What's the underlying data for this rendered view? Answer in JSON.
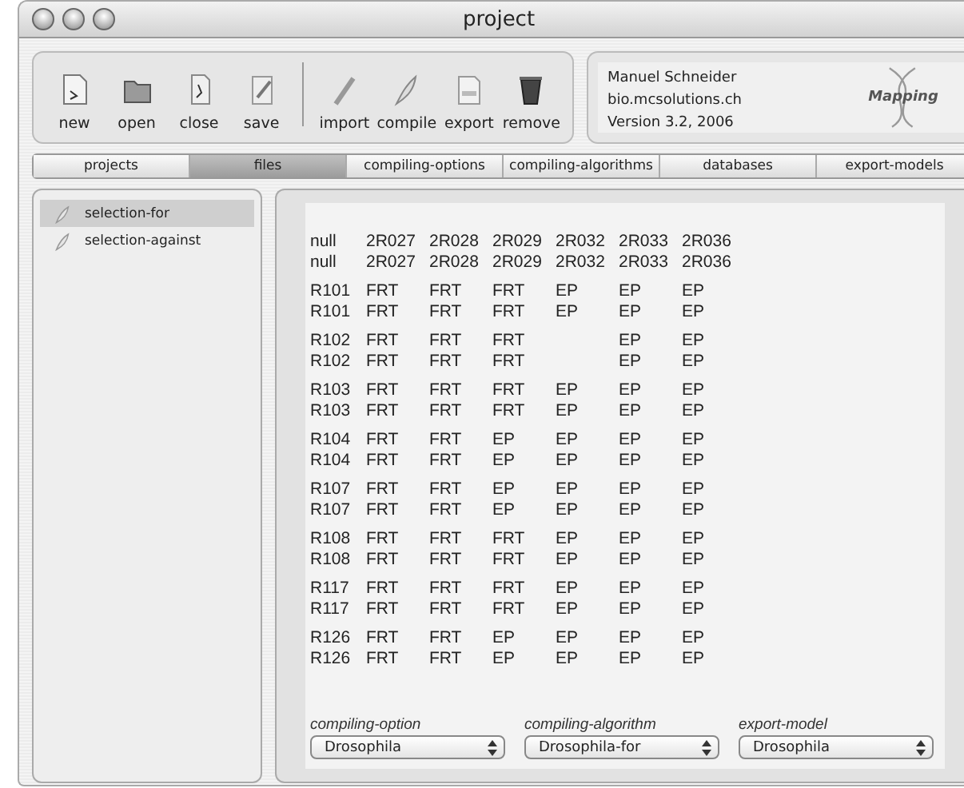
{
  "window": {
    "title": "project"
  },
  "toolbar": {
    "groups": [
      [
        {
          "label": "new",
          "kind": "new"
        },
        {
          "label": "open",
          "kind": "open"
        },
        {
          "label": "close",
          "kind": "close"
        },
        {
          "label": "save",
          "kind": "save"
        }
      ],
      [
        {
          "label": "import",
          "kind": "import"
        },
        {
          "label": "compile",
          "kind": "compile"
        },
        {
          "label": "export",
          "kind": "export"
        },
        {
          "label": "remove",
          "kind": "remove"
        }
      ]
    ]
  },
  "info": {
    "lines": [
      "Manuel Schneider",
      "bio.mcsolutions.ch",
      "Version 3.2, 2006"
    ],
    "logo": "Mapping"
  },
  "tabs": [
    {
      "label": "projects",
      "selected": false
    },
    {
      "label": "files",
      "selected": true
    },
    {
      "label": "compiling-options",
      "selected": false
    },
    {
      "label": "compiling-algorithms",
      "selected": false
    },
    {
      "label": "databases",
      "selected": false
    },
    {
      "label": "export-models",
      "selected": false
    }
  ],
  "sidebar": {
    "items": [
      {
        "label": "selection-for",
        "selected": true
      },
      {
        "label": "selection-against",
        "selected": false
      }
    ]
  },
  "table": {
    "groups": [
      {
        "rows": [
          [
            "null",
            "2R027",
            "2R028",
            "2R029",
            "2R032",
            "2R033",
            "2R036"
          ],
          [
            "null",
            "2R027",
            "2R028",
            "2R029",
            "2R032",
            "2R033",
            "2R036"
          ]
        ]
      },
      {
        "rows": [
          [
            "R101",
            "FRT",
            "FRT",
            "FRT",
            "EP",
            "EP",
            "EP"
          ],
          [
            "R101",
            "FRT",
            "FRT",
            "FRT",
            "EP",
            "EP",
            "EP"
          ]
        ]
      },
      {
        "rows": [
          [
            "R102",
            "FRT",
            "FRT",
            "FRT",
            null,
            "EP",
            "EP"
          ],
          [
            "R102",
            "FRT",
            "FRT",
            "FRT",
            null,
            "EP",
            "EP"
          ]
        ]
      },
      {
        "rows": [
          [
            "R103",
            "FRT",
            "FRT",
            "FRT",
            "EP",
            "EP",
            "EP"
          ],
          [
            "R103",
            "FRT",
            "FRT",
            "FRT",
            "EP",
            "EP",
            "EP"
          ]
        ]
      },
      {
        "rows": [
          [
            "R104",
            "FRT",
            "FRT",
            "EP",
            "EP",
            "EP",
            "EP"
          ],
          [
            "R104",
            "FRT",
            "FRT",
            "EP",
            "EP",
            "EP",
            "EP"
          ]
        ]
      },
      {
        "rows": [
          [
            "R107",
            "FRT",
            "FRT",
            "EP",
            "EP",
            "EP",
            "EP"
          ],
          [
            "R107",
            "FRT",
            "FRT",
            "EP",
            "EP",
            "EP",
            "EP"
          ]
        ]
      },
      {
        "rows": [
          [
            "R108",
            "FRT",
            "FRT",
            "FRT",
            "EP",
            "EP",
            "EP"
          ],
          [
            "R108",
            "FRT",
            "FRT",
            "FRT",
            "EP",
            "EP",
            "EP"
          ]
        ]
      },
      {
        "rows": [
          [
            "R117",
            "FRT",
            "FRT",
            "FRT",
            "EP",
            "EP",
            "EP"
          ],
          [
            "R117",
            "FRT",
            "FRT",
            "FRT",
            "EP",
            "EP",
            "EP"
          ]
        ]
      },
      {
        "rows": [
          [
            "R126",
            "FRT",
            "FRT",
            "EP",
            "EP",
            "EP",
            "EP"
          ],
          [
            "R126",
            "FRT",
            "FRT",
            "EP",
            "EP",
            "EP",
            "EP"
          ]
        ]
      }
    ]
  },
  "selectors": [
    {
      "label": "compiling-option",
      "value": "Drosophila"
    },
    {
      "label": "compiling-algorithm",
      "value": "Drosophila-for"
    },
    {
      "label": "export-model",
      "value": "Drosophila"
    }
  ]
}
